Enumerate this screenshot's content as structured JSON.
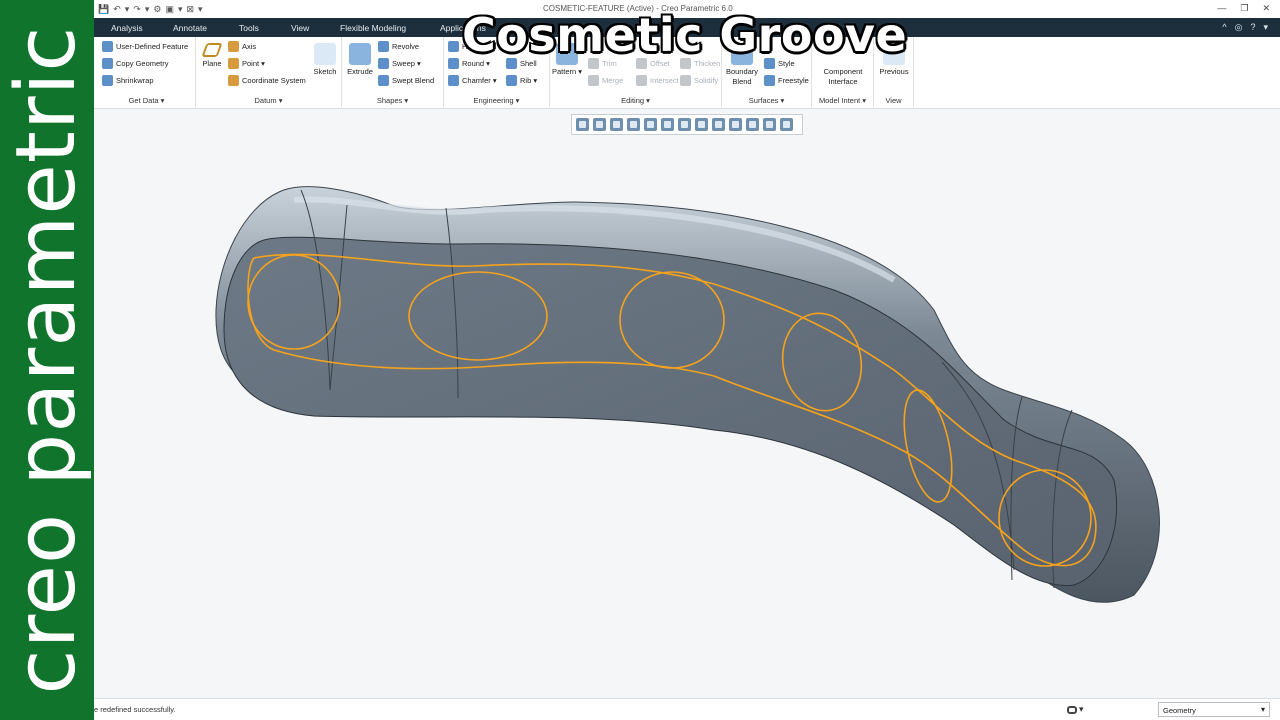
{
  "brand": {
    "text": "creo parametric"
  },
  "window": {
    "title": "COSMETIC-FEATURE (Active) - Creo Parametric 6.0",
    "quick_access": [
      "💾",
      "↶",
      "▾",
      "↷",
      "▾",
      "⚙",
      "▣",
      "▾",
      "⊠",
      "▾"
    ],
    "controls": [
      "—",
      "❐",
      "✕"
    ]
  },
  "tabs": [
    "Analysis",
    "Annotate",
    "Tools",
    "View",
    "Flexible Modeling",
    "Applications"
  ],
  "tab_icons": [
    "^",
    "◎",
    "?",
    "▾"
  ],
  "ribbon": {
    "get_data": {
      "label": "Get Data ▾",
      "items": [
        "User-Defined Feature",
        "Copy Geometry",
        "Shrinkwrap"
      ]
    },
    "datum": {
      "label": "Datum ▾",
      "plane": "Plane",
      "axis": "Axis",
      "point": "Point ▾",
      "csys": "Coordinate System",
      "sketch": "Sketch"
    },
    "shapes": {
      "label": "Shapes ▾",
      "extrude": "Extrude",
      "revolve": "Revolve",
      "sweep": "Sweep ▾",
      "swept_blend": "Swept Blend"
    },
    "engineering": {
      "label": "Engineering ▾",
      "hole": "Hole",
      "round": "Round ▾",
      "shell": "Shell",
      "chamfer": "Chamfer ▾",
      "rib": "Rib ▾"
    },
    "editing": {
      "label": "Editing ▾",
      "pattern": "Pattern ▾",
      "trim": "Trim",
      "offset": "Offset",
      "thicken": "Thicken",
      "merge": "Merge",
      "intersect": "Intersect",
      "solidify": "Solidify"
    },
    "surfaces": {
      "label": "Surfaces ▾",
      "boundary_blend": "Boundary Blend",
      "style": "Style",
      "freestyle": "Freestyle"
    },
    "model_intent": {
      "label": "Model Intent ▾",
      "component_interface": "Component Interface"
    },
    "view": {
      "label": "View",
      "previous": "Previous"
    }
  },
  "caption": "Cosmetic Groove",
  "status": {
    "message": "e redefined successfully.",
    "filter_value": "Geometry",
    "find_icon": "▾"
  },
  "colors": {
    "brand_green": "#10742c",
    "tab_bar": "#1d2f3d",
    "groove_orange": "#f5a21c",
    "model_steel": "#6f7c88"
  }
}
